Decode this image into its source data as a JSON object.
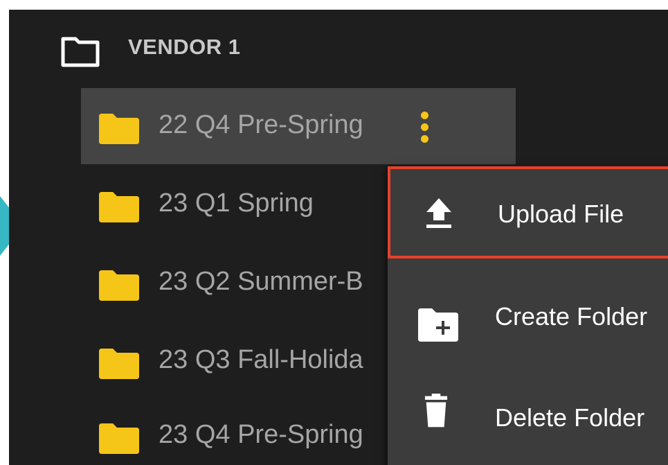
{
  "vendor": {
    "label": "VENDOR 1",
    "icon": "folder-outline-icon"
  },
  "folders": [
    {
      "label": "22 Q4 Pre-Spring",
      "icon": "folder-icon",
      "selected": true
    },
    {
      "label": "23 Q1 Spring",
      "icon": "folder-icon",
      "selected": false
    },
    {
      "label": "23 Q2 Summer-B",
      "icon": "folder-icon",
      "selected": false
    },
    {
      "label": "23 Q3 Fall-Holida",
      "icon": "folder-icon",
      "selected": false
    },
    {
      "label": "23 Q4 Pre-Spring",
      "icon": "folder-icon",
      "selected": false
    }
  ],
  "context_menu": {
    "items": [
      {
        "label": "Upload File",
        "icon": "upload-icon",
        "highlighted": true
      },
      {
        "label": "Create Folder",
        "icon": "create-folder-icon",
        "highlighted": false
      },
      {
        "label": "Delete Folder",
        "icon": "trash-icon",
        "highlighted": false
      }
    ]
  },
  "colors": {
    "panel_background": "#1e1e1e",
    "selected_row": "#444444",
    "folder_yellow": "#f5c518",
    "menu_background": "#3c3c3c",
    "highlight_border": "#e8402a",
    "pointer_arrow": "#36b8c4"
  }
}
